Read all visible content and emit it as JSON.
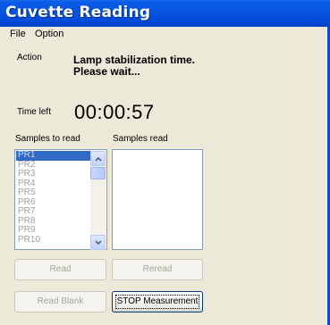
{
  "window": {
    "title": "Cuvette Reading"
  },
  "menu": {
    "file": "File",
    "option": "Option"
  },
  "status": {
    "action_label": "Action",
    "action_line1": "Lamp stabilization time.",
    "action_line2": "Please wait...",
    "time_left_label": "Time left",
    "time_left_value": "00:00:57"
  },
  "samples_to_read": {
    "label": "Samples to read",
    "items": [
      "PR1",
      "PR2",
      "PR3",
      "PR4",
      "PR5",
      "PR6",
      "PR7",
      "PR8",
      "PR9",
      "PR10"
    ],
    "selected": "PR1"
  },
  "samples_read": {
    "label": "Samples read",
    "items": []
  },
  "buttons": {
    "read": "Read",
    "reread": "Reread",
    "read_blank": "Read Blank",
    "stop": "STOP Measurement"
  }
}
